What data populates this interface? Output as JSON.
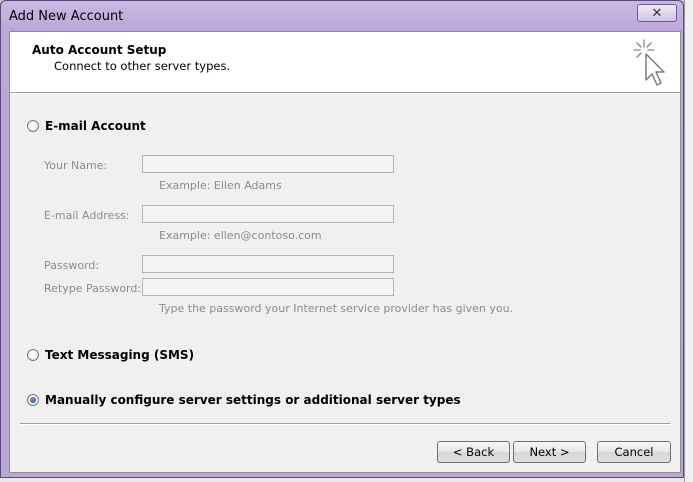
{
  "window": {
    "title": "Add New Account",
    "close_glyph": "✕"
  },
  "header": {
    "title": "Auto Account Setup",
    "subtitle": "Connect to other server types.",
    "icon": "cursor-sparkle-icon"
  },
  "options": {
    "email_account": {
      "label": "E-mail Account",
      "selected": false
    },
    "sms": {
      "label": "Text Messaging (SMS)",
      "selected": false
    },
    "manual": {
      "label": "Manually configure server settings or additional server types",
      "selected": true
    }
  },
  "form": {
    "your_name": {
      "label": "Your Name:",
      "value": "",
      "hint": "Example: Ellen Adams"
    },
    "email": {
      "label": "E-mail Address:",
      "value": "",
      "hint": "Example: ellen@contoso.com"
    },
    "password": {
      "label": "Password:",
      "value": ""
    },
    "retype_password": {
      "label": "Retype Password:",
      "value": "",
      "hint": "Type the password your Internet service provider has given you."
    }
  },
  "buttons": {
    "back": "< Back",
    "next": "Next >",
    "cancel": "Cancel"
  }
}
